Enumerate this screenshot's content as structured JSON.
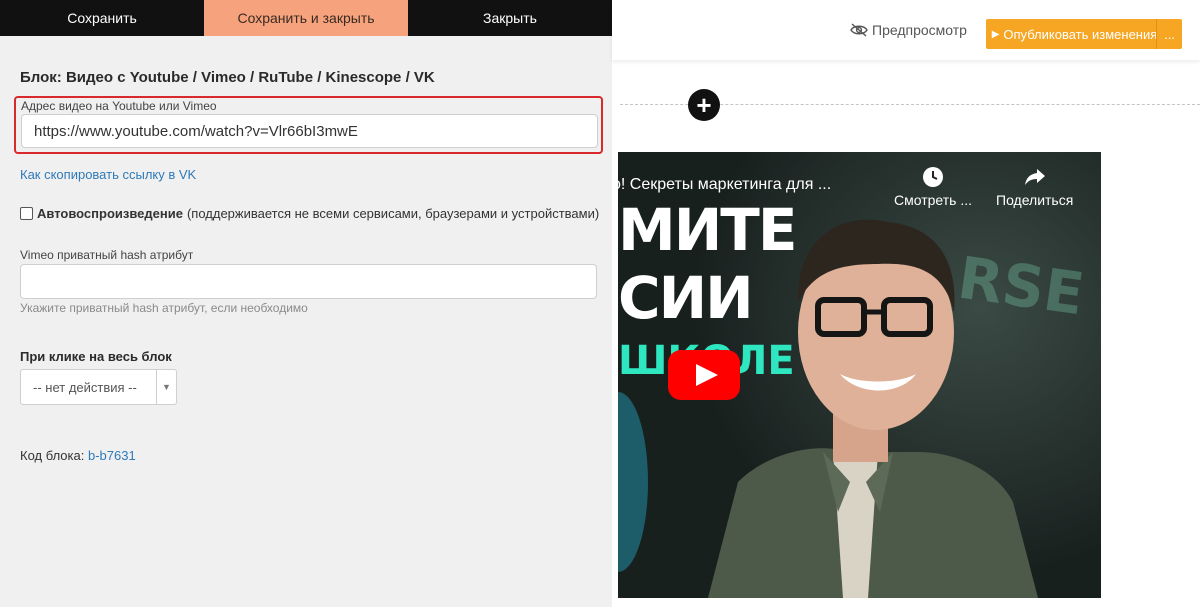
{
  "toolbar": {
    "save_label": "Сохранить",
    "save_close_label": "Сохранить и закрыть",
    "close_label": "Закрыть"
  },
  "form": {
    "block_title": "Блок: Видео с Youtube / Vimeo / RuTube / Kinescope / VK",
    "url_label": "Адрес видео на Youtube или Vimeo",
    "url_value": "https://www.youtube.com/watch?v=Vlr66bI3mwE",
    "vk_link": "Как скопировать ссылку в VK",
    "autoplay_label": "Автовоспроизведение",
    "autoplay_note": "(поддерживается не всеми сервисами, браузерами и устройствами)",
    "autoplay_checked": false,
    "hash_label": "Vimeo приватный hash атрибут",
    "hash_value": "",
    "hash_help": "Укажите приватный hash атрибут, если необходимо",
    "click_label": "При клике на весь блок",
    "click_select_value": "-- нет действия --",
    "code_label": "Код блока:",
    "code_value": "b-b7631"
  },
  "header": {
    "preview_label": "Предпросмотр",
    "publish_label": "Опубликовать изменения",
    "publish_more": "..."
  },
  "video": {
    "title": "о! Секреты маркетинга для ...",
    "watch_later": "Смотреть ...",
    "share": "Поделиться",
    "text_line1": "МИТЕ",
    "text_line2": "СИИ",
    "text_line3": "ШКОЛЕ",
    "bg_word": "RSE"
  },
  "colors": {
    "accent_orange": "#f6a623",
    "save_close_bg": "#f6a37d",
    "highlight_border": "#d8292c",
    "link": "#2f7ab8",
    "youtube_red": "#ff0000"
  },
  "icons": {
    "preview": "eye-slash-icon",
    "publish": "play-icon",
    "add": "plus-icon",
    "watch_later": "clock-icon",
    "share": "share-arrow-icon",
    "video_play": "youtube-play-icon"
  }
}
